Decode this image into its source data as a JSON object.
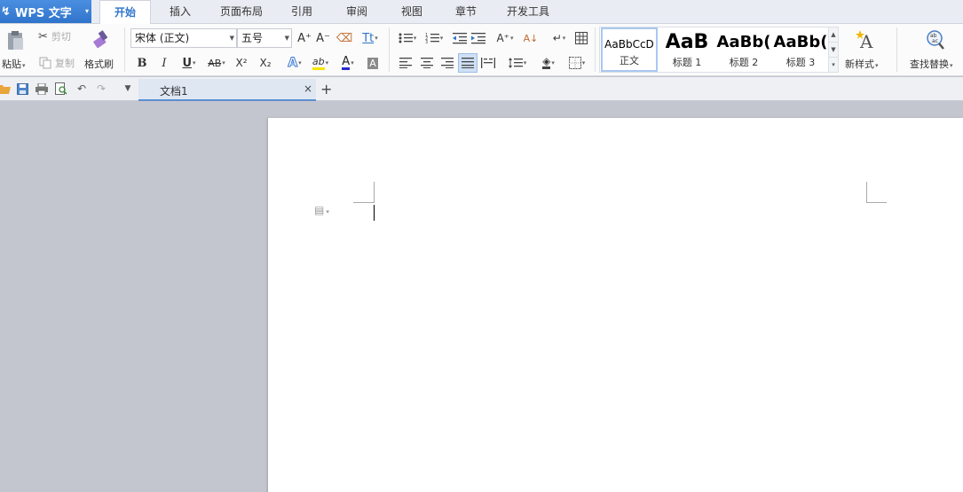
{
  "app": {
    "logo_glyph": "↯",
    "name": "WPS 文字",
    "arrow": "▾"
  },
  "menu": {
    "tabs": [
      {
        "label": "开始",
        "active": true
      },
      {
        "label": "插入"
      },
      {
        "label": "页面布局"
      },
      {
        "label": "引用"
      },
      {
        "label": "审阅"
      },
      {
        "label": "视图"
      },
      {
        "label": "章节"
      },
      {
        "label": "开发工具"
      }
    ]
  },
  "ribbon": {
    "clipboard": {
      "paste_label": "粘贴",
      "cut_label": "剪切",
      "copy_label": "复制",
      "format_painter_label": "格式刷"
    },
    "font": {
      "font_name": "宋体 (正文)",
      "font_size": "五号",
      "bold": "B",
      "italic": "I",
      "underline": "U",
      "strike": "AB",
      "superscript": "X²",
      "subscript": "X₂",
      "grow": "A⁺",
      "shrink": "A⁻",
      "text_effect": "A",
      "font_color": "A",
      "char_shading": "A",
      "highlight": "ab",
      "phonetic": "Tt"
    },
    "styles": {
      "items": [
        {
          "sample": "AaBbCcD",
          "name": "正文"
        },
        {
          "sample": "AaB",
          "name": "标题 1"
        },
        {
          "sample": "AaBb(",
          "name": "标题 2"
        },
        {
          "sample": "AaBb(",
          "name": "标题 3"
        }
      ],
      "new_style_label": "新样式"
    },
    "find_replace_label": "查找替换"
  },
  "quickbar": {
    "document_tab": "文档1",
    "close_glyph": "×",
    "new_tab_glyph": "+"
  },
  "colors": {
    "accent": "#2f74cc",
    "highlight_yellow": "#f5e600",
    "font_red": "#2a2ad0",
    "workspace": "#c4c6cf"
  }
}
